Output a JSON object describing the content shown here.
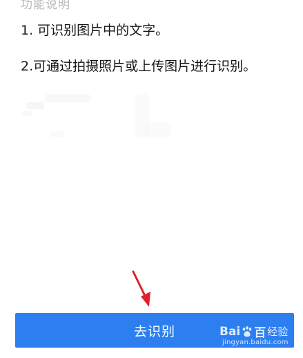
{
  "feature": {
    "heading": "功能说明",
    "items": [
      "1. 可识别图片中的文字。",
      "2.可通过拍摄照片或上传图片进行识别。"
    ]
  },
  "action": {
    "primary_label": "去识别"
  },
  "colors": {
    "primary": "#2d7ff0",
    "annotation_arrow": "#e0202a"
  },
  "watermark": {
    "logo_left": "Bai",
    "logo_right": "百",
    "suffix": "经验",
    "url": "jingyan.baidu.com"
  }
}
